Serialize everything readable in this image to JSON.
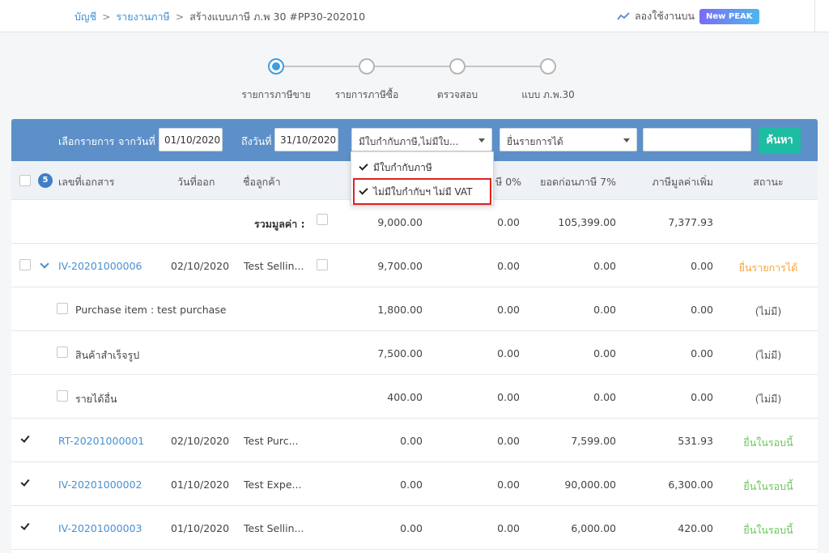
{
  "breadcrumb": {
    "accounting": "บัญชี",
    "sep": ">",
    "tax_report": "รายงานภาษี",
    "current": "สร้างแบบภาษี ภ.พ 30 #PP30-202010"
  },
  "try_new": {
    "label": "ลองใช้งานบน",
    "badge": "New PEAK"
  },
  "steps": [
    {
      "label": "รายการภาษีขาย",
      "active": true
    },
    {
      "label": "รายการภาษีซื้อ",
      "active": false
    },
    {
      "label": "ตรวจสอบ",
      "active": false
    },
    {
      "label": "แบบ ภ.พ.30",
      "active": false
    }
  ],
  "filter": {
    "select_label": "เลือกรายการ",
    "from_label": "จากวันที่",
    "from_value": "01/10/2020",
    "to_label": "ถึงวันที่",
    "to_value": "31/10/2020",
    "tax_invoice_value": "มีใบกำกับภาษี,ไม่มีใบ...",
    "filing_value": "ยื่นรายการได้",
    "search_value": "",
    "search_button": "ค้นหา"
  },
  "dropdown": {
    "options": [
      {
        "label": "มีใบกำกับภาษี",
        "checked": true
      },
      {
        "label": "ไม่มีใบกำกับฯ ไม่มี VAT",
        "checked": true
      }
    ]
  },
  "table": {
    "selected_count": "5",
    "headers": {
      "doc_no": "เลขที่เอกสาร",
      "issue_date": "วันที่ออก",
      "customer": "ชื่อลูกค้า",
      "zero_vat": "ษี 0%",
      "pre_tax": "ยอดก่อนภาษี 7%",
      "vat": "ภาษีมูลค่าเพิ่ม",
      "status": "สถานะ"
    },
    "total": {
      "label": "รวมมูลค่า :",
      "exempt": "9,000.00",
      "zero": "0.00",
      "pre_tax": "105,399.00",
      "vat": "7,377.93"
    },
    "rows": [
      {
        "doc": "IV-20201000006",
        "date": "02/10/2020",
        "customer": "Test Sellin...",
        "exempt": "9,700.00",
        "zero": "0.00",
        "pre_tax": "0.00",
        "vat": "0.00",
        "status": "ยื่นรายการได้"
      },
      {
        "item": "Purchase item : test purchase",
        "exempt": "1,800.00",
        "zero": "0.00",
        "pre_tax": "0.00",
        "vat": "0.00",
        "status": "(ไม่มี)"
      },
      {
        "item": "สินค้าสำเร็จรูป",
        "exempt": "7,500.00",
        "zero": "0.00",
        "pre_tax": "0.00",
        "vat": "0.00",
        "status": "(ไม่มี)"
      },
      {
        "item": "รายได้อื่น",
        "exempt": "400.00",
        "zero": "0.00",
        "pre_tax": "0.00",
        "vat": "0.00",
        "status": "(ไม่มี)"
      },
      {
        "doc": "RT-20201000001",
        "date": "02/10/2020",
        "customer": "Test Purc...",
        "exempt": "0.00",
        "zero": "0.00",
        "pre_tax": "7,599.00",
        "vat": "531.93",
        "status": "ยื่นในรอบนี้"
      },
      {
        "doc": "IV-20201000002",
        "date": "01/10/2020",
        "customer": "Test Expe...",
        "exempt": "0.00",
        "zero": "0.00",
        "pre_tax": "90,000.00",
        "vat": "6,300.00",
        "status": "ยื่นในรอบนี้"
      },
      {
        "doc": "IV-20201000003",
        "date": "01/10/2020",
        "customer": "Test Sellin...",
        "exempt": "0.00",
        "zero": "0.00",
        "pre_tax": "6,000.00",
        "vat": "420.00",
        "status": "ยื่นในรอบนี้"
      }
    ]
  }
}
